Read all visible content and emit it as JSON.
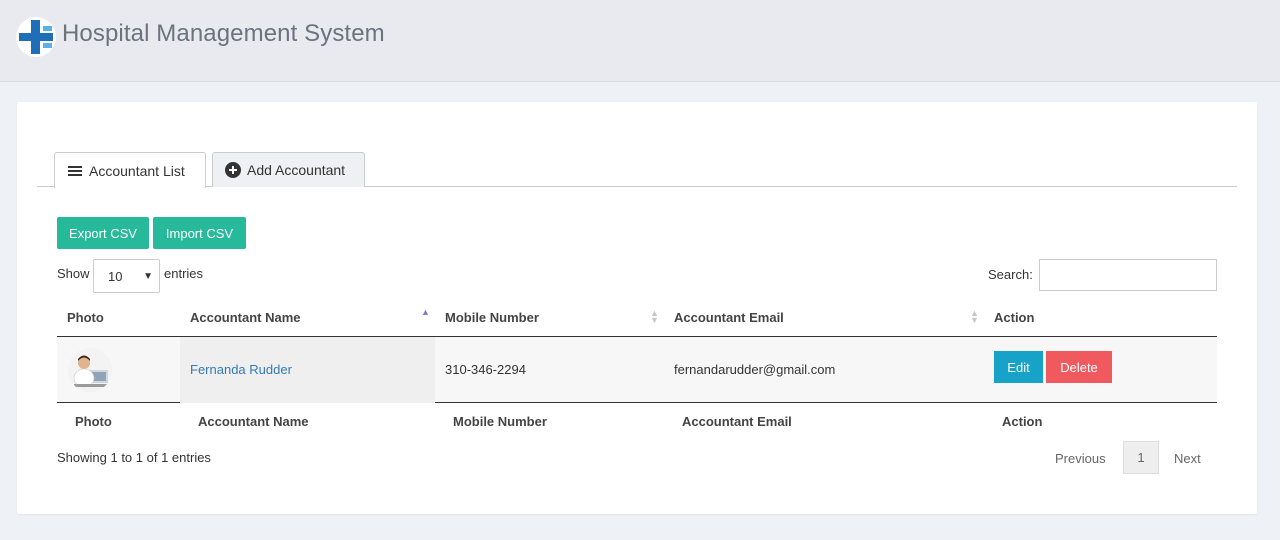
{
  "app": {
    "title": "Hospital Management System"
  },
  "tabs": [
    {
      "label": "Accountant List",
      "icon": "list-icon"
    },
    {
      "label": "Add Accountant",
      "icon": "plus-circle-icon"
    }
  ],
  "toolbar": {
    "export_label": "Export CSV",
    "import_label": "Import CSV"
  },
  "length": {
    "show": "Show",
    "value": "10",
    "entries": "entries"
  },
  "search": {
    "label": "Search:",
    "value": ""
  },
  "table": {
    "columns": [
      "Photo",
      "Accountant Name",
      "Mobile Number",
      "Accountant Email",
      "Action"
    ],
    "rows": [
      {
        "name": "Fernanda Rudder",
        "mobile": "310-346-2294",
        "email": "fernandarudder@gmail.com",
        "edit": "Edit",
        "delete": "Delete"
      }
    ]
  },
  "info": "Showing 1 to 1 of 1 entries",
  "pagination": {
    "previous": "Previous",
    "page": "1",
    "next": "Next"
  },
  "colors": {
    "green": "#26b99a",
    "edit": "#17a2c8",
    "delete": "#f05a5f",
    "link": "#337ab7"
  }
}
